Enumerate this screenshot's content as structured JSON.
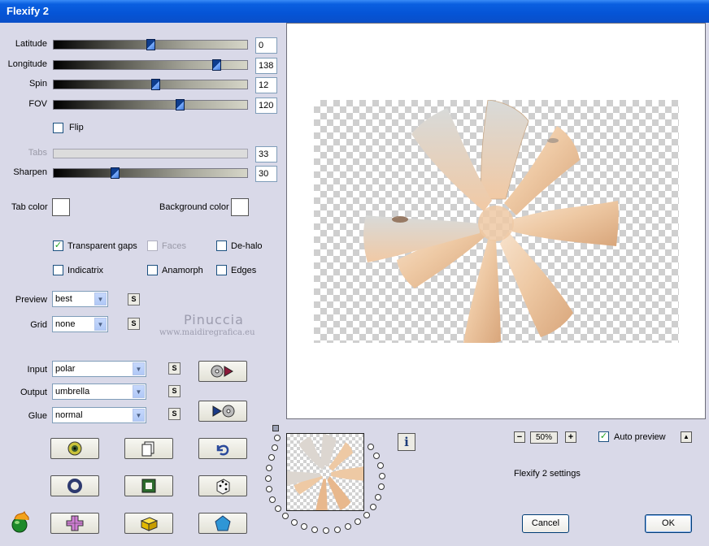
{
  "window": {
    "title": "Flexify 2"
  },
  "sliders": [
    {
      "label": "Latitude",
      "value": "0",
      "position": 0.5
    },
    {
      "label": "Longitude",
      "value": "138",
      "position": 0.86
    },
    {
      "label": "Spin",
      "value": "12",
      "position": 0.53
    },
    {
      "label": "FOV",
      "value": "120",
      "position": 0.66
    }
  ],
  "flip": {
    "label": "Flip",
    "checked": false
  },
  "tabs_slider": {
    "label": "Tabs",
    "value": "33",
    "disabled": true
  },
  "sharpen": {
    "label": "Sharpen",
    "value": "30",
    "position": 0.31
  },
  "colors": {
    "tab_label": "Tab color",
    "tab_color": "#ffffff",
    "bg_label": "Background color",
    "bg_color": "#ffffff"
  },
  "options": {
    "transparent_gaps": {
      "label": "Transparent gaps",
      "checked": true
    },
    "faces": {
      "label": "Faces",
      "checked": false,
      "disabled": true
    },
    "de_halo": {
      "label": "De-halo",
      "checked": false
    },
    "indicatrix": {
      "label": "Indicatrix",
      "checked": false
    },
    "anamorph": {
      "label": "Anamorph",
      "checked": false
    },
    "edges": {
      "label": "Edges",
      "checked": false
    }
  },
  "preview_select": {
    "label": "Preview",
    "value": "best"
  },
  "grid_select": {
    "label": "Grid",
    "value": "none"
  },
  "input_select": {
    "label": "Input",
    "value": "polar"
  },
  "output_select": {
    "label": "Output",
    "value": "umbrella"
  },
  "glue_select": {
    "label": "Glue",
    "value": "normal"
  },
  "small_button_label": "S",
  "watermark": {
    "name": "Pinuccia",
    "url": "www.maidiregrafica.eu"
  },
  "zoom": {
    "value": "50%",
    "minus": "−",
    "plus": "+"
  },
  "auto_preview": {
    "label": "Auto preview",
    "checked": true
  },
  "settings_caption": "Flexify 2 settings",
  "buttons": {
    "cancel": "Cancel",
    "ok": "OK",
    "info": "i",
    "up": "▲"
  },
  "icons": {
    "row1": [
      "eye-ball-icon",
      "copy-icon",
      "undo-arrow-icon"
    ],
    "row2": [
      "ring-icon",
      "square-icon",
      "dice-icon"
    ],
    "row3": [
      "cross-shape-icon",
      "cube-shape-icon",
      "pentagon-icon"
    ]
  },
  "accent_colors": {
    "title_bar": "#0554d6",
    "check_green": "#21a121",
    "slider_thumb": "#0e3d8e",
    "petal": "#eec9a4"
  }
}
